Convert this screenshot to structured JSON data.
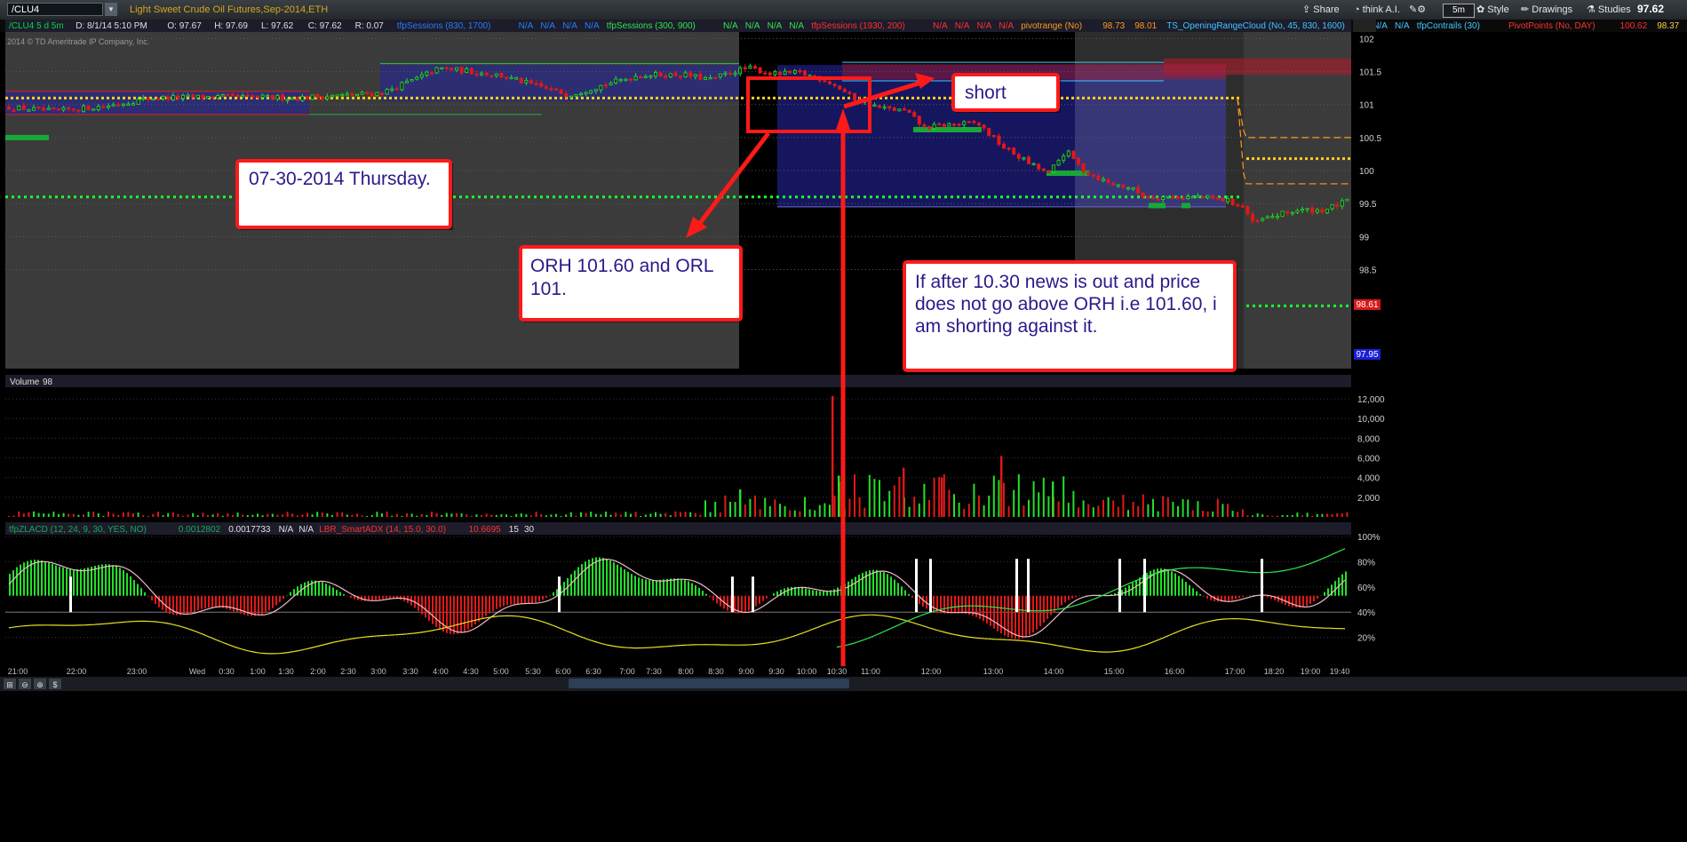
{
  "toolbar": {
    "symbol": "/CLU4",
    "description": "Light Sweet Crude Oil Futures,Sep-2014,ETH",
    "share_label": "Share",
    "think_label": "think A.I.",
    "aggregation_label": "5m",
    "style_label": "Style",
    "drawings_label": "Drawings",
    "studies_label": "Studies",
    "last_price": "97.62"
  },
  "header": [
    {
      "text": "/CLU4 5 d 5m",
      "color": "#00d84a"
    },
    {
      "text": "D: 8/1/14 5:10 PM",
      "color": "#e0e0e0"
    },
    {
      "text": "O: 97.67",
      "color": "#e0e0e0"
    },
    {
      "text": "H: 97.69",
      "color": "#e0e0e0"
    },
    {
      "text": "L: 97.62",
      "color": "#e0e0e0"
    },
    {
      "text": "C: 97.62",
      "color": "#e0e0e0"
    },
    {
      "text": "R: 0.07",
      "color": "#e0e0e0"
    },
    {
      "text": "tfpSessions (830, 1700)",
      "color": "#2a7bff"
    },
    {
      "text": "N/A",
      "color": "#2a7bff"
    },
    {
      "text": "N/A",
      "color": "#2a7bff"
    },
    {
      "text": "N/A",
      "color": "#2a7bff"
    },
    {
      "text": "N/A",
      "color": "#2a7bff"
    },
    {
      "text": "tfpSessions (300, 900)",
      "color": "#2ee84a"
    },
    {
      "text": "N/A",
      "color": "#2ee84a"
    },
    {
      "text": "N/A",
      "color": "#2ee84a"
    },
    {
      "text": "N/A",
      "color": "#2ee84a"
    },
    {
      "text": "N/A",
      "color": "#2ee84a"
    },
    {
      "text": "tfpSessions (1930, 200)",
      "color": "#ff3030"
    },
    {
      "text": "N/A",
      "color": "#ff3030"
    },
    {
      "text": "N/A",
      "color": "#ff3030"
    },
    {
      "text": "N/A",
      "color": "#ff3030"
    },
    {
      "text": "N/A",
      "color": "#ff3030"
    },
    {
      "text": "pivotrange (No)",
      "color": "#ff9a1a"
    },
    {
      "text": "98.73",
      "color": "#ff9a1a"
    },
    {
      "text": "98.01",
      "color": "#ff9a1a"
    },
    {
      "text": "TS_OpeningRangeCloud (No, 45, 830, 1600)",
      "color": "#40c8ff"
    },
    {
      "text": "N/A",
      "color": "#40c8ff"
    },
    {
      "text": "N/A",
      "color": "#40c8ff"
    },
    {
      "text": "tfpContrails (30)",
      "color": "#40c8ff"
    },
    {
      "text": "PivotPoints (No, DAY)",
      "color": "#ff3030"
    },
    {
      "text": "100.62",
      "color": "#ff3030"
    },
    {
      "text": "98.37",
      "color": "#ffd040"
    }
  ],
  "copyright": "2014 © TD Ameritrade IP Company, Inc.",
  "volume_header": [
    "Volume",
    "98"
  ],
  "lower_header": [
    {
      "text": "tfpZLACD (12, 24, 9, 30, YES, NO)",
      "color": "#1aa858"
    },
    {
      "text": "0.0012802",
      "color": "#1aa858"
    },
    {
      "text": "0.0017733",
      "color": "#e0e0e0"
    },
    {
      "text": "N/A",
      "color": "#e0e0e0"
    },
    {
      "text": "N/A",
      "color": "#e0e0e0"
    },
    {
      "text": "LBR_SmartADX (14, 15.0, 30.0)",
      "color": "#ff3030"
    },
    {
      "text": "10.6695",
      "color": "#ff3030"
    },
    {
      "text": "15",
      "color": "#e0e0e0"
    },
    {
      "text": "30",
      "color": "#e0e0e0"
    }
  ],
  "annotations": {
    "date_box": "07-30-2014 Thursday.",
    "orh_box": "ORH 101.60 and ORL 101.",
    "short_box": "short",
    "note_box": "If after 10.30 news is out and price does not go above ORH i.e 101.60, i am shorting against it."
  },
  "colors": {
    "up": "#22e02a",
    "down": "#e01818",
    "annotation_border": "#ff1a1a",
    "annotation_text": "#2a1a8a",
    "pivot_yellow": "#ffd21a",
    "green_dots": "#18ff30"
  },
  "chart_data": [
    {
      "type": "candlestick",
      "title": "",
      "ylim": [
        97.0,
        102.1
      ],
      "y_ticks": [
        102,
        101.5,
        101,
        100.5,
        100,
        99.5,
        99,
        98.5
      ],
      "price_badges": [
        "98.61",
        "97.95"
      ],
      "x_ticks": [
        "21:00",
        "22:00",
        "23:00",
        "Wed",
        "0:30",
        "1:00",
        "1:30",
        "2:00",
        "2:30",
        "3:00",
        "3:30",
        "4:00",
        "4:30",
        "5:00",
        "5:30",
        "6:00",
        "6:30",
        "7:00",
        "7:30",
        "8:00",
        "8:30",
        "9:00",
        "9:30",
        "10:00",
        "10:30",
        "11:00",
        "12:00",
        "13:00",
        "14:00",
        "15:00",
        "16:00",
        "17:00",
        "18:20",
        "19:00",
        "19:40"
      ],
      "levels": {
        "opening_range_high": 101.6,
        "opening_range_low": 101.0,
        "pivot_dotted": 101.1,
        "green_dotted": 99.6
      },
      "price_path": [
        [
          0,
          100.97
        ],
        [
          60,
          100.9
        ],
        [
          120,
          100.98
        ],
        [
          170,
          101.1
        ],
        [
          250,
          101.12
        ],
        [
          330,
          101.1
        ],
        [
          400,
          101.15
        ],
        [
          430,
          101.18
        ],
        [
          470,
          101.4
        ],
        [
          495,
          101.55
        ],
        [
          530,
          101.5
        ],
        [
          560,
          101.45
        ],
        [
          600,
          101.3
        ],
        [
          640,
          101.15
        ],
        [
          680,
          101.3
        ],
        [
          720,
          101.45
        ],
        [
          770,
          101.45
        ],
        [
          800,
          101.38
        ],
        [
          830,
          101.52
        ],
        [
          845,
          101.55
        ],
        [
          870,
          101.46
        ],
        [
          900,
          101.48
        ],
        [
          930,
          101.37
        ],
        [
          945,
          101.25
        ],
        [
          960,
          101.1
        ],
        [
          990,
          100.95
        ],
        [
          1020,
          100.9
        ],
        [
          1040,
          100.65
        ],
        [
          1070,
          100.7
        ],
        [
          1100,
          100.72
        ],
        [
          1130,
          100.35
        ],
        [
          1160,
          100.1
        ],
        [
          1180,
          99.95
        ],
        [
          1200,
          100.3
        ],
        [
          1220,
          100.0
        ],
        [
          1250,
          99.8
        ],
        [
          1270,
          99.75
        ],
        [
          1290,
          99.6
        ],
        [
          1320,
          99.6
        ],
        [
          1350,
          99.6
        ],
        [
          1380,
          99.55
        ],
        [
          1400,
          99.45
        ],
        [
          1410,
          99.2
        ],
        [
          1430,
          99.3
        ],
        [
          1460,
          99.4
        ],
        [
          1490,
          99.4
        ],
        [
          1520,
          99.55
        ]
      ]
    },
    {
      "type": "bar",
      "title": "",
      "ylabel": "",
      "ylim": [
        0,
        13000
      ],
      "y_ticks": [
        "12,000",
        "10,000",
        "8,000",
        "6,000",
        "4,000",
        "2,000"
      ],
      "typical_volume_before_open": 300,
      "spikes": [
        {
          "x": 937,
          "value": 12300,
          "color": "red"
        },
        {
          "x": 944,
          "value": 4200,
          "color": "green"
        },
        {
          "x": 1017,
          "value": 5000,
          "color": "red"
        },
        {
          "x": 1127,
          "value": 6200,
          "color": "red"
        },
        {
          "x": 1185,
          "value": 3600,
          "color": "green"
        },
        {
          "x": 833,
          "value": 2800,
          "color": "green"
        },
        {
          "x": 1060,
          "value": 4000,
          "color": "red"
        }
      ]
    },
    {
      "type": "line",
      "title": "",
      "ylim": [
        0,
        100
      ],
      "y_ticks": [
        "100%",
        "80%",
        "60%",
        "40%",
        "20%"
      ]
    }
  ]
}
